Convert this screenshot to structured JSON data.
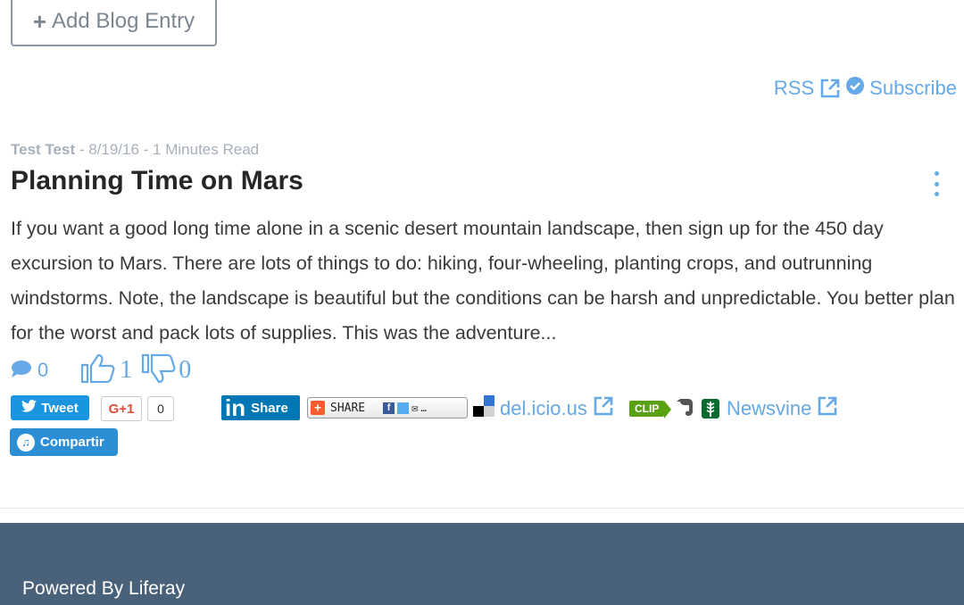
{
  "toolbar": {
    "add_label": "Add Blog Entry"
  },
  "feeds": {
    "rss_label": "RSS",
    "subscribe_label": "Subscribe"
  },
  "entry": {
    "author": "Test Test",
    "meta_rest": " - 8/19/16 - 1 Minutes Read",
    "title": "Planning Time on Mars",
    "summary": "If you want a good long time alone in a scenic desert mountain landscape, then sign up for the 450 day excursion to Mars. There are lots of things to do: hiking, four-wheeling, planting crops, and outrunning windstorms. Note, the landscape is beautiful but the conditions can be harsh and unpredictable. You better plan for the worst and pack lots of supplies. This was the adventure..."
  },
  "ratings": {
    "comments": "0",
    "likes": "1",
    "dislikes": "0"
  },
  "social": {
    "tweet": "Tweet",
    "gplus": "G+1",
    "gplus_count": "0",
    "linkedin": "Share",
    "addthis": "SHARE",
    "delicious": "del.icio.us",
    "clip": "CLIP",
    "newsvine": "Newsvine",
    "compartir": "Compartir"
  },
  "colors": {
    "accent": "#65a9e6",
    "footer_bg": "#4a6279",
    "tweet_bg": "#1b95e0",
    "linkedin_bg": "#0077b5"
  },
  "footer": {
    "powered": "Powered By Liferay"
  }
}
